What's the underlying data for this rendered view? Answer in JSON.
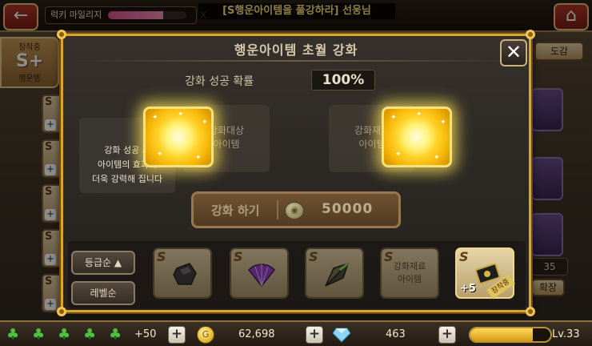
{
  "header": {
    "back_icon": "arrow-left-icon",
    "home_icon": "house-icon",
    "mileage_label": "럭키 마일리지",
    "mileage_fraction": 0.7,
    "mileage_close": "X",
    "title_banner": "[S행운아이템을 풀강하라] 선웅님"
  },
  "background": {
    "side_tab": {
      "top": "장착중",
      "main": "S+",
      "bottom": "행운템"
    },
    "slot_letter": "S",
    "slot_plus": "+",
    "dictionary_button": "도감",
    "capacity_count": "35",
    "expand_button": "확장"
  },
  "modal": {
    "title": "행운아이템 초월 강화",
    "close_label": "✕",
    "success_rate_label": "강화 성공 확률",
    "success_rate_value": "100%",
    "target_slot_text": "강화대상\n아이템",
    "material_slot_text": "강화재료\n아이템",
    "tooltip_text": "강화 성공 시\n아이템의 효과가\n더욱 강력해 집니다",
    "enhance_button_label": "강화 하기",
    "enhance_cost": "50000",
    "sort_grade_label": "등급순 ▲",
    "sort_level_label": "레벨순",
    "items": [
      {
        "letter": "S",
        "name": "black-stone",
        "color": "#2a2a2a"
      },
      {
        "letter": "S",
        "name": "purple-fan",
        "color": "#7a2fa8"
      },
      {
        "letter": "S",
        "name": "dark-arrowhead",
        "color": "#3a3a2a"
      },
      {
        "letter": "S",
        "name": "material-slot",
        "text": "강화재료\n아이템"
      },
      {
        "letter": "S",
        "name": "black-card",
        "plus": "+5",
        "ribbon": "장착중"
      }
    ]
  },
  "status_bar": {
    "clover_icon": "clover-icon",
    "clover_count": 5,
    "clover_extra": "+50",
    "gold_icon": "gold-coin-icon",
    "gold": "62,698",
    "gem_icon": "diamond-icon",
    "gems": "463",
    "level_fraction": 0.78,
    "level": "Lv.33"
  },
  "colors": {
    "modal_border": "#d9a52c",
    "glow": "#ffe866",
    "banner_text": "#ffe27a"
  }
}
